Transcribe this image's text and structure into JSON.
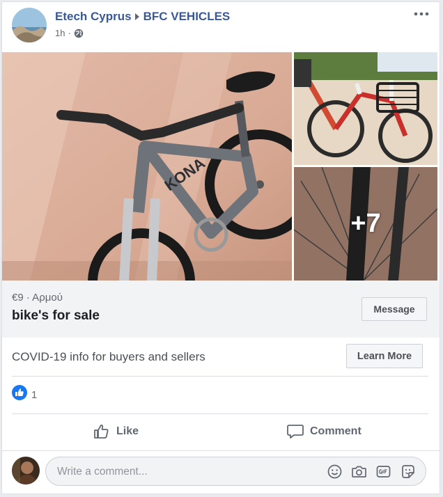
{
  "post": {
    "author": "Etech Cyprus",
    "group": "BFC VEHICLES",
    "time": "1h",
    "audience_icon": "globe-icon",
    "more_icon": "more-horizontal-icon"
  },
  "photos": {
    "more_count": "+7",
    "main_subject": "grey mountain bike against wall",
    "top_right_subject": "red and white city bike with basket",
    "bottom_right_subject": "close-up of bike fork"
  },
  "listing": {
    "price_location": "€9 · Αρμού",
    "title": "bike's for sale",
    "message_label": "Message"
  },
  "covid": {
    "text": "COVID-19 info for buyers and sellers",
    "learn_more_label": "Learn More"
  },
  "reactions": {
    "like_count": "1",
    "like_color": "#1877f2"
  },
  "actions": {
    "like_label": "Like",
    "comment_label": "Comment"
  },
  "comment_box": {
    "placeholder": "Write a comment...",
    "icons": [
      "emoji-icon",
      "camera-icon",
      "gif-icon",
      "sticker-icon"
    ]
  },
  "colors": {
    "link": "#385898",
    "secondary_text": "#606770",
    "panel_bg": "#f2f3f5"
  }
}
